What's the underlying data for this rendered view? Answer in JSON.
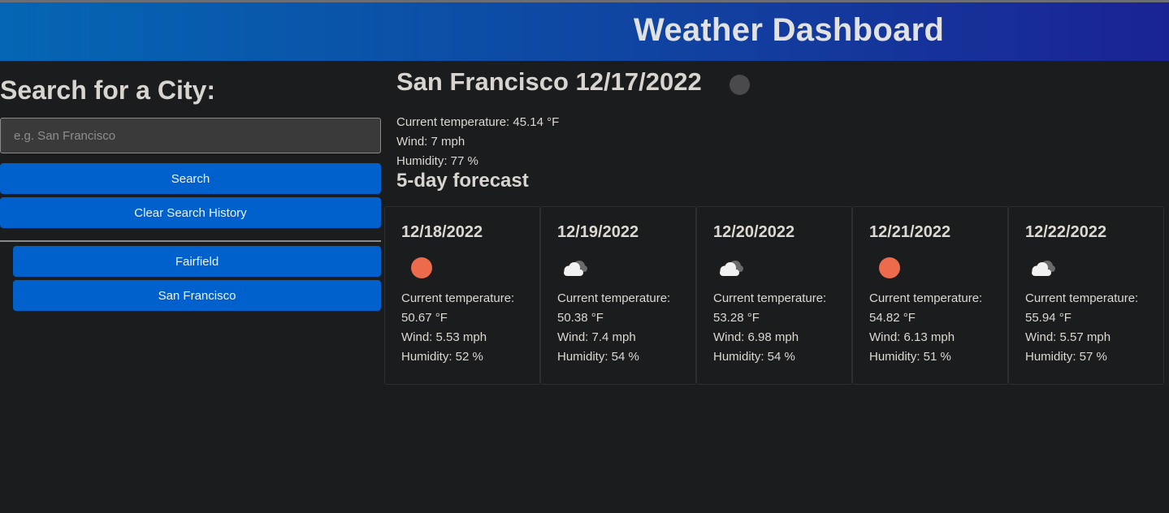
{
  "header": {
    "title": "Weather Dashboard"
  },
  "sidebar": {
    "title": "Search for a City:",
    "search_placeholder": "e.g. San Francisco",
    "search_value": "",
    "search_label": "Search",
    "clear_label": "Clear Search History",
    "history": [
      "Fairfield",
      "San Francisco"
    ]
  },
  "current": {
    "title": "San Francisco 12/17/2022",
    "icon": "weather-icon",
    "temperature": "Current temperature: 45.14 °F",
    "wind": "Wind: 7 mph",
    "humidity": "Humidity: 77 %"
  },
  "forecast": {
    "title": "5-day forecast",
    "days": [
      {
        "date": "12/18/2022",
        "icon": "sun-icon",
        "temp_label": "Current temperature:",
        "temp_value": "50.67 °F",
        "wind": "Wind: 5.53 mph",
        "humidity": "Humidity: 52 %"
      },
      {
        "date": "12/19/2022",
        "icon": "cloud-icon",
        "temp_label": "Current temperature:",
        "temp_value": "50.38 °F",
        "wind": "Wind: 7.4 mph",
        "humidity": "Humidity: 54 %"
      },
      {
        "date": "12/20/2022",
        "icon": "cloud-icon",
        "temp_label": "Current temperature:",
        "temp_value": "53.28 °F",
        "wind": "Wind: 6.98 mph",
        "humidity": "Humidity: 54 %"
      },
      {
        "date": "12/21/2022",
        "icon": "sun-icon",
        "temp_label": "Current temperature:",
        "temp_value": "54.82 °F",
        "wind": "Wind: 6.13 mph",
        "humidity": "Humidity: 51 %"
      },
      {
        "date": "12/22/2022",
        "icon": "cloud-icon",
        "temp_label": "Current temperature:",
        "temp_value": "55.94 °F",
        "wind": "Wind: 5.57 mph",
        "humidity": "Humidity: 57 %"
      }
    ]
  },
  "colors": {
    "header_gradient_start": "#0466b4",
    "header_gradient_end": "#1a2393",
    "button_blue": "#0061cc",
    "sun": "#ec6b4c",
    "background": "#1b1c1e"
  }
}
